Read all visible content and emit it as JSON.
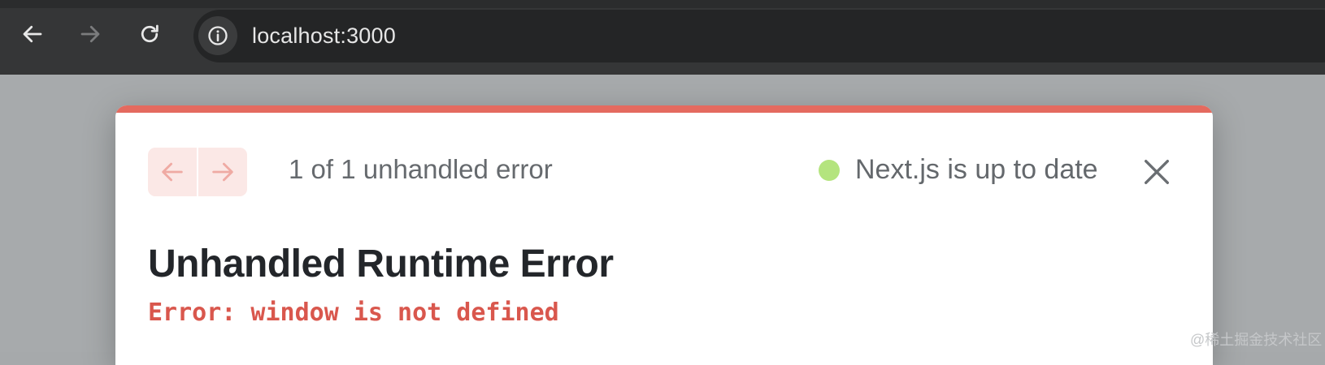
{
  "browser": {
    "url": "localhost:3000",
    "back_icon": "arrow-left",
    "forward_icon": "arrow-right",
    "reload_icon": "reload",
    "site_info_icon": "info-circle"
  },
  "overlay": {
    "accent_color": "#e46a5f",
    "error_count": "1 of 1 unhandled error",
    "version_status": "Next.js is up to date",
    "status_color": "#b4e47e",
    "title": "Unhandled Runtime Error",
    "error_message": "Error: window is not defined"
  },
  "watermark": "@稀土掘金技术社区"
}
